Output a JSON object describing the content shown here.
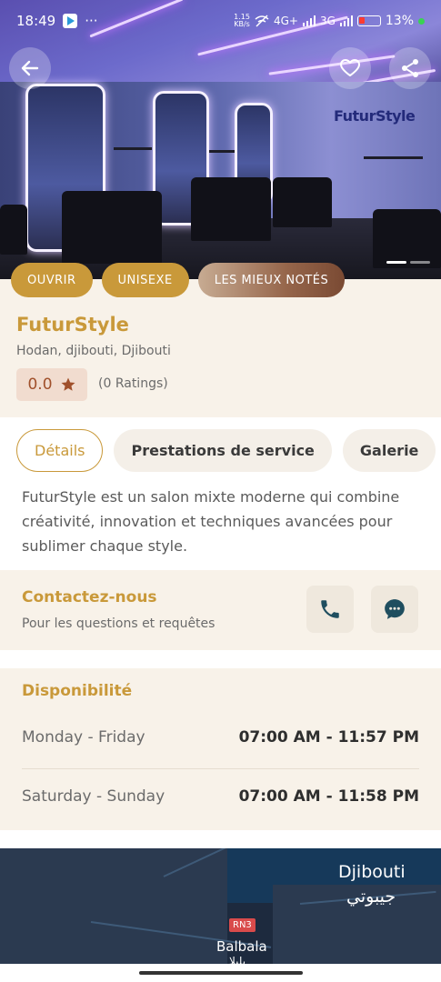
{
  "status_bar": {
    "time": "18:49",
    "dots": "···",
    "speed_top": "1.15",
    "speed_unit": "KB/s",
    "network_1": "4G+",
    "network_2": "3G",
    "battery_pct": "13%"
  },
  "hero": {
    "logo_text": "FuturStyle",
    "slide_count": 2,
    "active_slide": 1
  },
  "tags": [
    {
      "label": "OUVRIR"
    },
    {
      "label": "UNISEXE"
    },
    {
      "label": "LES MIEUX NOTÉS"
    }
  ],
  "salon": {
    "name": "FuturStyle",
    "address": "Hodan, djibouti, Djibouti",
    "rating": "0.0",
    "rating_count": "(0 Ratings)"
  },
  "tabs": [
    {
      "label": "Détails",
      "active": true
    },
    {
      "label": "Prestations de service",
      "active": false
    },
    {
      "label": "Galerie",
      "active": false
    }
  ],
  "description": "FuturStyle est un salon mixte moderne qui combine créativité, innovation et techniques avancées pour sublimer chaque style.",
  "contact": {
    "title": "Contactez-nous",
    "subtitle": "Pour les questions et requêtes"
  },
  "availability": {
    "title": "Disponibilité",
    "rows": [
      {
        "day": "Monday - Friday",
        "hours": "07:00 AM - 11:57 PM"
      },
      {
        "day": "Saturday - Sunday",
        "hours": "07:00 AM - 11:58 PM"
      }
    ]
  },
  "map": {
    "city": "Djibouti",
    "city_ar": "جيبوتي",
    "road_badge": "RN3",
    "district": "Balbala",
    "district_ar": "بلبلا"
  },
  "colors": {
    "accent_gold": "#c9993a",
    "cream_bg": "#f8f2e9",
    "icon_teal": "#1f4e5f"
  },
  "icons": {
    "back": "arrow-left-icon",
    "favorite": "heart-icon",
    "share": "share-icon",
    "rating": "star-icon",
    "call": "phone-icon",
    "chat": "chat-bubble-icon"
  }
}
